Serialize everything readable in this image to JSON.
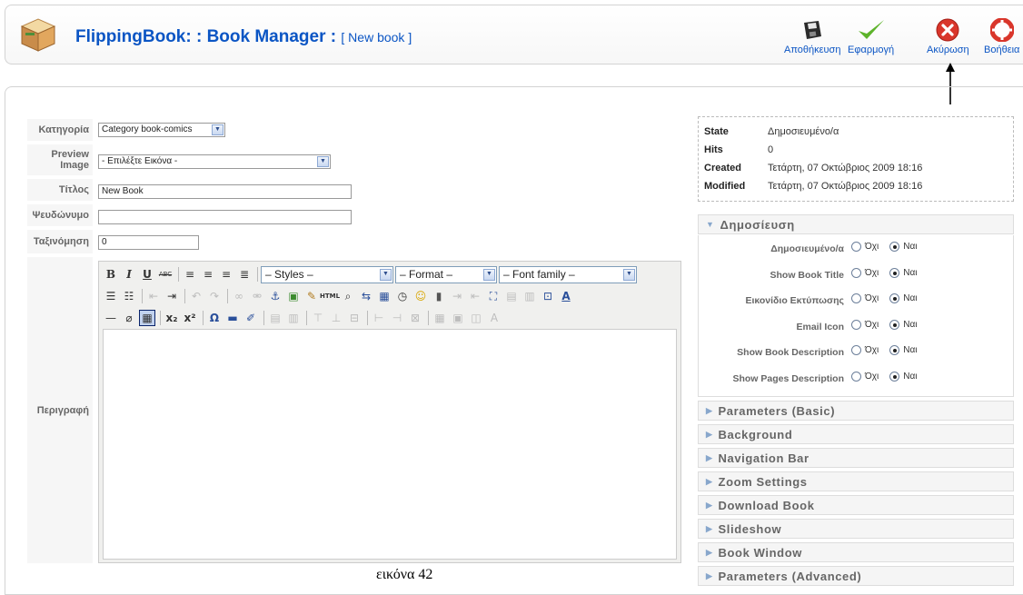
{
  "header": {
    "title": "FlippingBook: : Book Manager :",
    "subtitle": "[ New book ]"
  },
  "toolbar": {
    "save_label": "Αποθήκευση",
    "apply_label": "Εφαρμογή",
    "cancel_label": "Ακύρωση",
    "help_label": "Βοήθεια"
  },
  "form": {
    "category_label": "Κατηγορία",
    "category_value": "Category book-comics",
    "preview_label": "Preview Image",
    "preview_value": "- Επιλέξτε Εικόνα -",
    "title_label": "Τίτλος",
    "title_value": "New Book",
    "alias_label": "Ψευδώνυμο",
    "alias_value": "",
    "ordering_label": "Ταξινόμηση",
    "ordering_value": "0",
    "description_label": "Περιγραφή"
  },
  "editor": {
    "styles": "– Styles –",
    "format": "– Format –",
    "font_family": "– Font family –"
  },
  "info": {
    "state_key": "State",
    "state_value": "Δημοσιευμένο/α",
    "hits_key": "Hits",
    "hits_value": "0",
    "created_key": "Created",
    "created_value": "Τετάρτη, 07 Οκτώβριος 2009 18:16",
    "modified_key": "Modified",
    "modified_value": "Τετάρτη, 07 Οκτώβριος 2009 18:16"
  },
  "publish": {
    "header": "Δημοσίευση",
    "no_label": "Όχι",
    "yes_label": "Ναι",
    "rows": [
      {
        "label": "Δημοσιευμένο/α",
        "selected": "yes"
      },
      {
        "label": "Show Book Title",
        "selected": "yes"
      },
      {
        "label": "Εικονίδιο Εκτύπωσης",
        "selected": "yes"
      },
      {
        "label": "Email Icon",
        "selected": "yes"
      },
      {
        "label": "Show Book Description",
        "selected": "yes"
      },
      {
        "label": "Show Pages Description",
        "selected": "yes"
      }
    ]
  },
  "panels": [
    "Parameters (Basic)",
    "Background",
    "Navigation Bar",
    "Zoom Settings",
    "Download Book",
    "Slideshow",
    "Book Window",
    "Parameters (Advanced)"
  ],
  "caption": "εικόνα 42",
  "colors": {
    "link_blue": "#0b55c4",
    "apply_green": "#5db32b",
    "cancel_red": "#d9362b"
  }
}
